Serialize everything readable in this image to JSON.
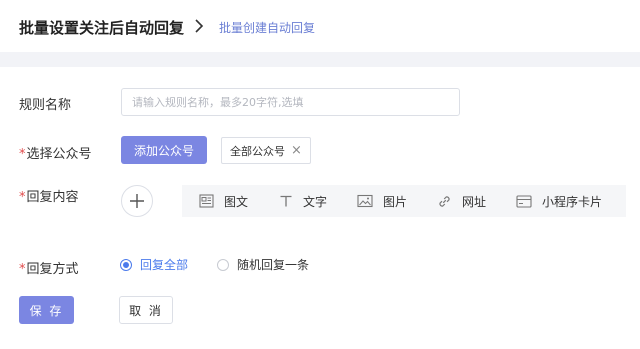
{
  "breadcrumb": {
    "parent": "批量设置关注后自动回复",
    "current": "批量创建自动回复"
  },
  "form": {
    "rule_name": {
      "label": "规则名称",
      "placeholder": "请输入规则名称，最多20字符,选填",
      "value": ""
    },
    "account": {
      "required_mark": "*",
      "label": "选择公众号",
      "add_button": "添加公众号",
      "tag": "全部公众号",
      "tag_close": "×"
    },
    "content": {
      "required_mark": "*",
      "label": "回复内容",
      "types": [
        {
          "label": "图文",
          "icon": "article-icon"
        },
        {
          "label": "文字",
          "icon": "text-icon"
        },
        {
          "label": "图片",
          "icon": "image-icon"
        },
        {
          "label": "网址",
          "icon": "link-icon"
        },
        {
          "label": "小程序卡片",
          "icon": "mini-program-card-icon"
        }
      ]
    },
    "mode": {
      "required_mark": "*",
      "label": "回复方式",
      "options": [
        {
          "label": "回复全部",
          "selected": true
        },
        {
          "label": "随机回复一条",
          "selected": false
        }
      ]
    }
  },
  "actions": {
    "save": "保 存",
    "cancel": "取 消"
  },
  "colors": {
    "accent": "#7b86e2",
    "link": "#6b7fd4",
    "radio_active": "#4b7bec",
    "required": "#e14b4b"
  }
}
